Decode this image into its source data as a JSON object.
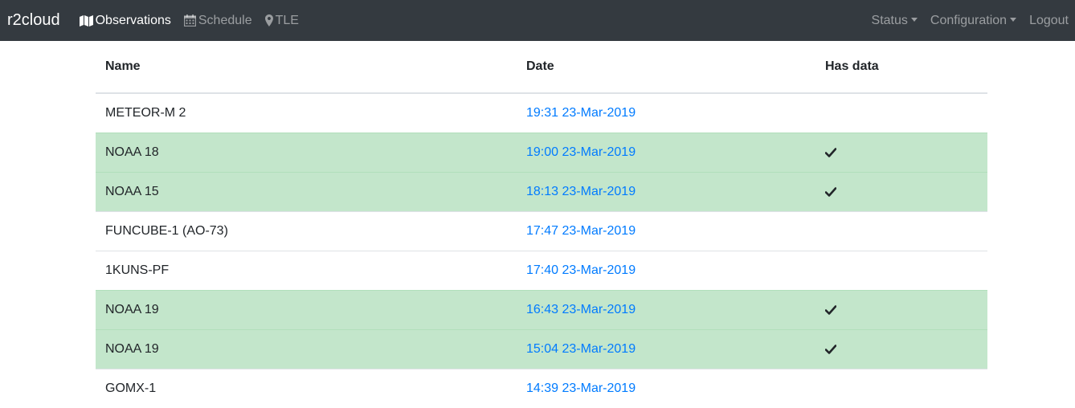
{
  "navbar": {
    "brand": "r2cloud",
    "left_items": [
      {
        "label": "Observations",
        "icon": "map-icon",
        "active": true
      },
      {
        "label": "Schedule",
        "icon": "calendar-icon",
        "active": false
      },
      {
        "label": "TLE",
        "icon": "map-marker-icon",
        "active": false
      }
    ],
    "right_items": [
      {
        "label": "Status",
        "dropdown": true
      },
      {
        "label": "Configuration",
        "dropdown": true
      },
      {
        "label": "Logout",
        "dropdown": false
      }
    ]
  },
  "table": {
    "headers": [
      "Name",
      "Date",
      "Has data"
    ],
    "rows": [
      {
        "name": "METEOR-M 2",
        "date": "19:31 23-Mar-2019",
        "has_data": false
      },
      {
        "name": "NOAA 18",
        "date": "19:00 23-Mar-2019",
        "has_data": true
      },
      {
        "name": "NOAA 15",
        "date": "18:13 23-Mar-2019",
        "has_data": true
      },
      {
        "name": "FUNCUBE-1 (AO-73)",
        "date": "17:47 23-Mar-2019",
        "has_data": false
      },
      {
        "name": "1KUNS-PF",
        "date": "17:40 23-Mar-2019",
        "has_data": false
      },
      {
        "name": "NOAA 19",
        "date": "16:43 23-Mar-2019",
        "has_data": true
      },
      {
        "name": "NOAA 19",
        "date": "15:04 23-Mar-2019",
        "has_data": true
      },
      {
        "name": "GOMX-1",
        "date": "14:39 23-Mar-2019",
        "has_data": false
      }
    ]
  },
  "colors": {
    "navbar_bg": "#343a40",
    "success_row": "#c3e6cb",
    "link": "#007bff"
  }
}
